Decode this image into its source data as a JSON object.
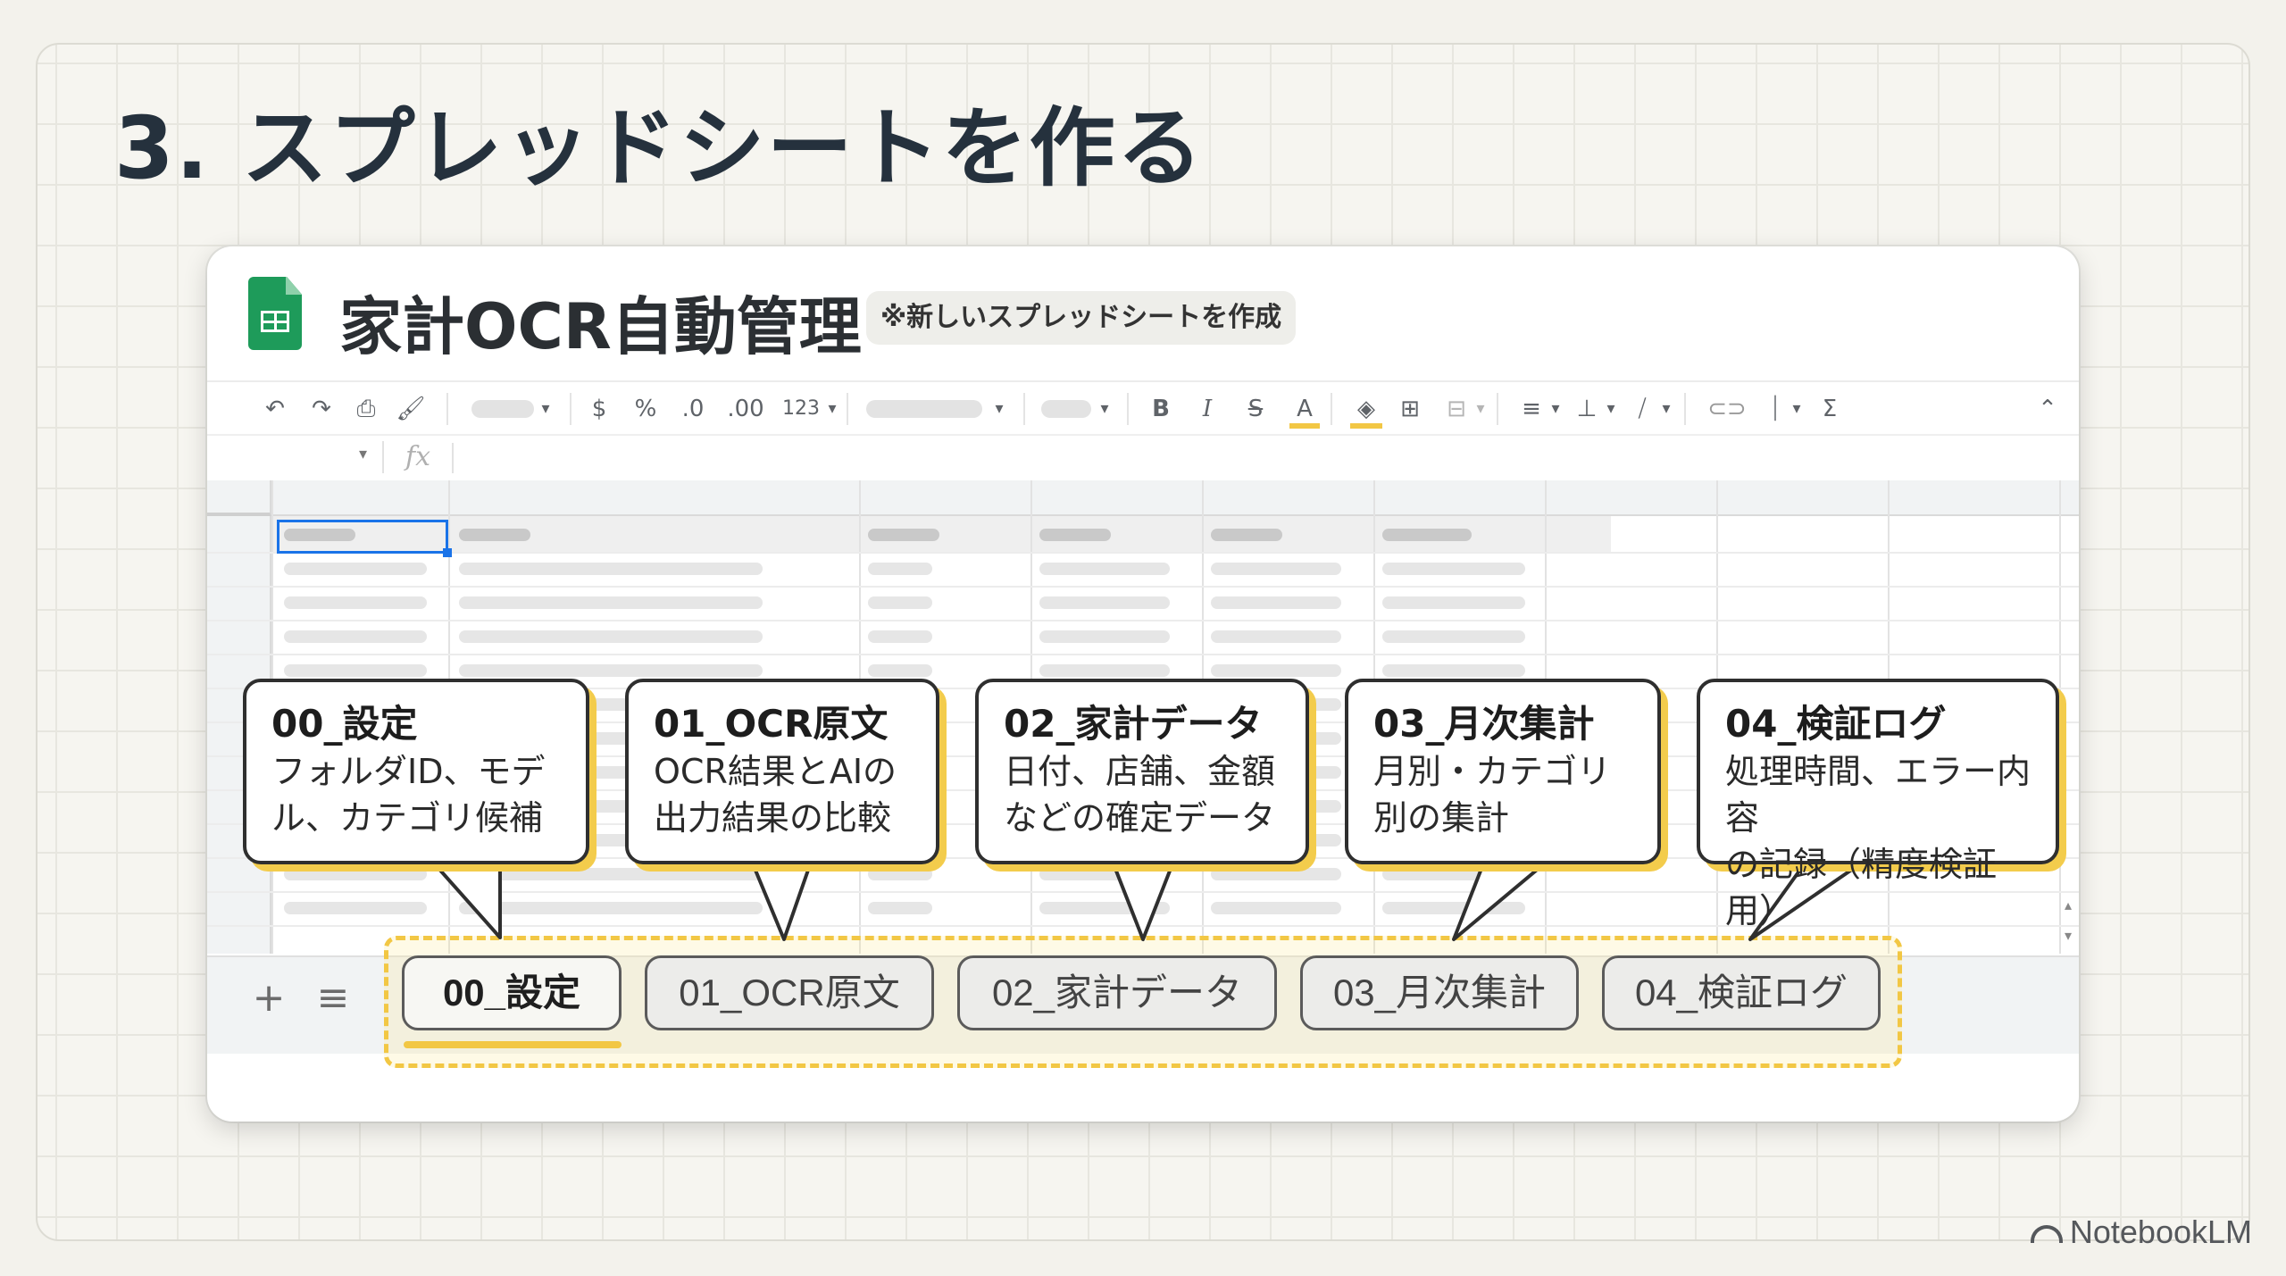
{
  "slide": {
    "title": "3. スプレッドシートを作る"
  },
  "window": {
    "app_icon": "google-sheets-icon",
    "document_title": "家計OCR自動管理",
    "note": "※新しいスプレッドシートを作成",
    "toolbar_icons": [
      "undo-icon",
      "redo-icon",
      "print-icon",
      "paint-format-icon",
      "zoom-dropdown",
      "currency-icon",
      "percent-icon",
      "decrease-decimal-icon",
      "increase-decimal-icon",
      "number-format-dropdown",
      "font-dropdown",
      "font-size-dropdown",
      "bold-icon",
      "italic-icon",
      "strikethrough-icon",
      "text-color-icon",
      "fill-color-icon",
      "borders-icon",
      "merge-cells-icon",
      "horizontal-align-icon",
      "vertical-align-icon",
      "text-rotation-icon",
      "link-icon",
      "filter-icon",
      "functions-icon",
      "collapse-icon"
    ],
    "toolbar_text": {
      "currency": "$",
      "percent": "%",
      "decrease_decimal": ".0",
      "increase_decimal": ".00",
      "number_format": "123",
      "bold": "B",
      "italic": "I",
      "strike": "S",
      "text_color": "A",
      "functions": "Σ",
      "fx": "fx"
    }
  },
  "sheet_tabs": [
    {
      "label": "00_設定",
      "active": true
    },
    {
      "label": "01_OCR原文",
      "active": false
    },
    {
      "label": "02_家計データ",
      "active": false
    },
    {
      "label": "03_月次集計",
      "active": false
    },
    {
      "label": "04_検証ログ",
      "active": false
    }
  ],
  "tab_bar": {
    "add": "+",
    "menu": "≡"
  },
  "callouts": [
    {
      "title": "00_設定",
      "desc": "フォルダID、モデ\nル、カテゴリ候補"
    },
    {
      "title": "01_OCR原文",
      "desc": "OCR結果とAIの\n出力結果の比較"
    },
    {
      "title": "02_家計データ",
      "desc": "日付、店舗、金額\nなどの確定データ"
    },
    {
      "title": "03_月次集計",
      "desc": "月別・カテゴリ\n別の集計"
    },
    {
      "title": "04_検証ログ",
      "desc": "処理時間、エラー内容\nの記録（精度検証用）"
    }
  ],
  "colors": {
    "accent": "#f2c744",
    "sheets_green": "#1e9b5a",
    "title": "#25313d"
  },
  "watermark": "NotebookLM"
}
